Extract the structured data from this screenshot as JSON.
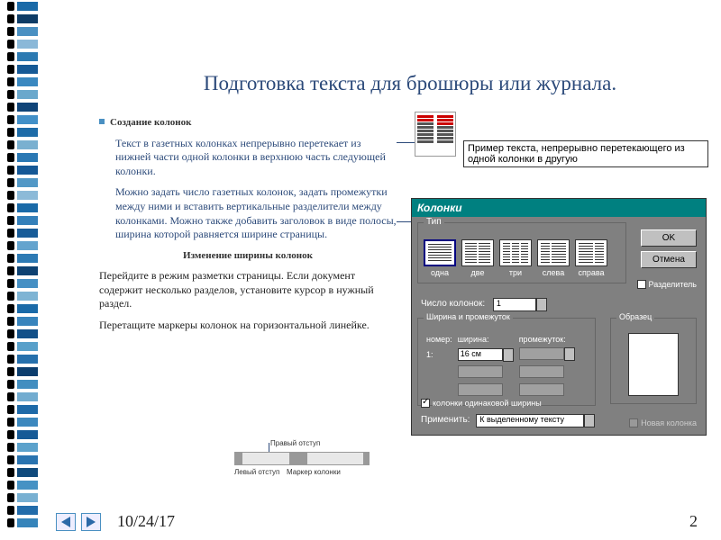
{
  "spiral_colors": [
    "#1a6aa8",
    "#0e3c66",
    "#4a90c2",
    "#8ab8d8",
    "#2c7ab2",
    "#165a96",
    "#3a88c0",
    "#6aa8cc",
    "#0f4478",
    "#4290c8",
    "#1e6ca8",
    "#7ab0d0",
    "#2a78b4",
    "#155896",
    "#5298c6",
    "#8cbad8",
    "#1a6aa8",
    "#3480ba",
    "#185c98",
    "#64a4ce",
    "#2c7ab4",
    "#0e4272",
    "#4690c4",
    "#7eb4d4",
    "#1a6aa8",
    "#3884bc",
    "#125088",
    "#58a0ca",
    "#2670ac",
    "#0c3e6e",
    "#428ec0",
    "#72acd0",
    "#1e6aa8",
    "#3c88be",
    "#165a96",
    "#5ca2cc",
    "#2a74b0",
    "#104a7c",
    "#4692c4",
    "#78b0d2",
    "#226caa",
    "#3684ba"
  ],
  "title": "Подготовка текста для брошюры или журнала.",
  "body": {
    "heading1": "Создание колонок",
    "p1": "Текст в газетных колонках непрерывно перетекает из нижней части одной колонки в верхнюю часть следующей колонки.",
    "p2": "Можно задать число газетных колонок, задать промежутки между ними и вставить вертикальные разделители между колонками. Можно также добавить заголовок в виде полосы, ширина которой равняется ширине страницы.",
    "heading2": "Изменение ширины колонок",
    "p3": "Перейдите в режим разметки страницы. Если документ содержит несколько разделов, установите курсор в нужный раздел.",
    "p4": "Перетащите маркеры колонок на горизонтальной линейке."
  },
  "example_caption": "Пример текста, непрерывно перетекающего из одной колонки в другую",
  "dialog": {
    "title": "Колонки",
    "group_type": "Тип",
    "col_options": [
      "одна",
      "две",
      "три",
      "слева",
      "справа"
    ],
    "btn_ok": "OK",
    "btn_cancel": "Отмена",
    "chk_separator": "Разделитель",
    "num_cols_label": "Число колонок:",
    "num_cols_value": "1",
    "group_wg": "Ширина и промежуток",
    "wg_headers": [
      "номер:",
      "ширина:",
      "промежуток:"
    ],
    "wg_row1_num": "1:",
    "wg_row1_width": "16 см",
    "chk_equal": "колонки одинаковой ширины",
    "group_sample": "Образец",
    "apply_label": "Применить:",
    "apply_value": "К выделенному тексту",
    "chk_newcol": "Новая колонка"
  },
  "ruler": {
    "label1": "Правый отступ",
    "label2": "Левый отступ",
    "label3": "Маркер колонки"
  },
  "footer": {
    "date": "10/24/17",
    "page": "2"
  }
}
